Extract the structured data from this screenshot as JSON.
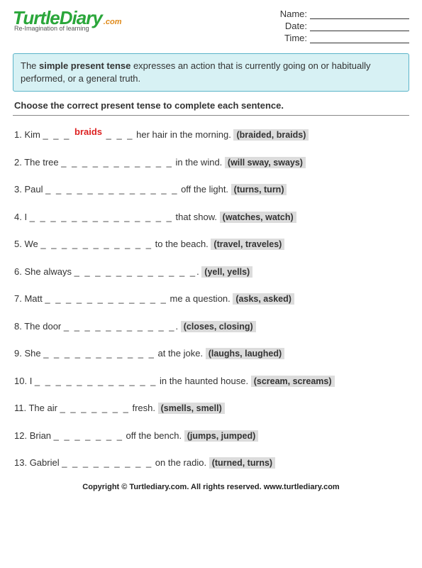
{
  "logo": {
    "main": "TurtleDiary",
    "suffix": ".com",
    "tagline": "Re-Imagination of learning"
  },
  "fields": {
    "name": "Name:",
    "date": "Date:",
    "time": "Time:"
  },
  "rule": {
    "pre": "The ",
    "bold": "simple present tense",
    "post": " expresses an action that is currently going on or habitually performed, or a general truth."
  },
  "instruction": "Choose the correct present tense to complete each sentence.",
  "questions": [
    {
      "n": "1.",
      "pre": "Kim ",
      "blank": "_ _ _ ",
      "answer": "braids",
      "blank2": " _ _ _",
      "post": " her hair in the morning.  ",
      "opts": "(braided, braids)"
    },
    {
      "n": "2.",
      "pre": "The tree ",
      "blank": "_ _ _ _ _ _ _ _ _ _ _",
      "post": " in the wind.  ",
      "opts": "(will sway, sways)"
    },
    {
      "n": "3.",
      "pre": "Paul ",
      "blank": "_ _ _ _ _ _ _ _ _ _ _ _ _",
      "post": " off the light.  ",
      "opts": "(turns, turn)"
    },
    {
      "n": "4.",
      "pre": "I ",
      "blank": "_ _ _ _ _ _ _ _ _ _ _ _ _ _",
      "post": " that show.  ",
      "opts": "(watches, watch)"
    },
    {
      "n": "5.",
      "pre": "We ",
      "blank": "_ _ _ _ _ _ _ _ _ _ _",
      "post": " to the beach.  ",
      "opts": "(travel, traveles)"
    },
    {
      "n": "6.",
      "pre": "She always ",
      "blank": "_ _ _ _ _ _ _ _ _ _ _ _",
      "post": ".  ",
      "opts": "(yell, yells)"
    },
    {
      "n": "7.",
      "pre": "Matt ",
      "blank": "_ _ _ _ _ _ _ _ _ _ _ _",
      "post": " me a question.  ",
      "opts": "(asks, asked)"
    },
    {
      "n": "8.",
      "pre": "The door ",
      "blank": "_ _ _ _ _ _ _ _ _ _ _",
      "post": ".  ",
      "opts": "(closes, closing)"
    },
    {
      "n": "9.",
      "pre": "She ",
      "blank": "_ _ _ _ _ _ _ _ _ _ _",
      "post": " at the joke.  ",
      "opts": "(laughs, laughed)"
    },
    {
      "n": "10.",
      "pre": "I ",
      "blank": "_ _ _ _ _ _ _ _ _ _ _ _",
      "post": " in the haunted house.  ",
      "opts": "(scream, screams)"
    },
    {
      "n": "11.",
      "pre": "The air ",
      "blank": "_ _ _ _ _ _ _",
      "post": " fresh.  ",
      "opts": "(smells, smell)"
    },
    {
      "n": "12.",
      "pre": "Brian ",
      "blank": "_ _ _ _ _ _ _",
      "post": " off the bench.  ",
      "opts": "(jumps, jumped)"
    },
    {
      "n": "13.",
      "pre": "Gabriel ",
      "blank": "_ _ _ _ _ _ _ _ _",
      "post": " on the radio.  ",
      "opts": "(turned, turns)"
    }
  ],
  "footer": "Copyright © Turtlediary.com. All rights reserved. www.turtlediary.com"
}
